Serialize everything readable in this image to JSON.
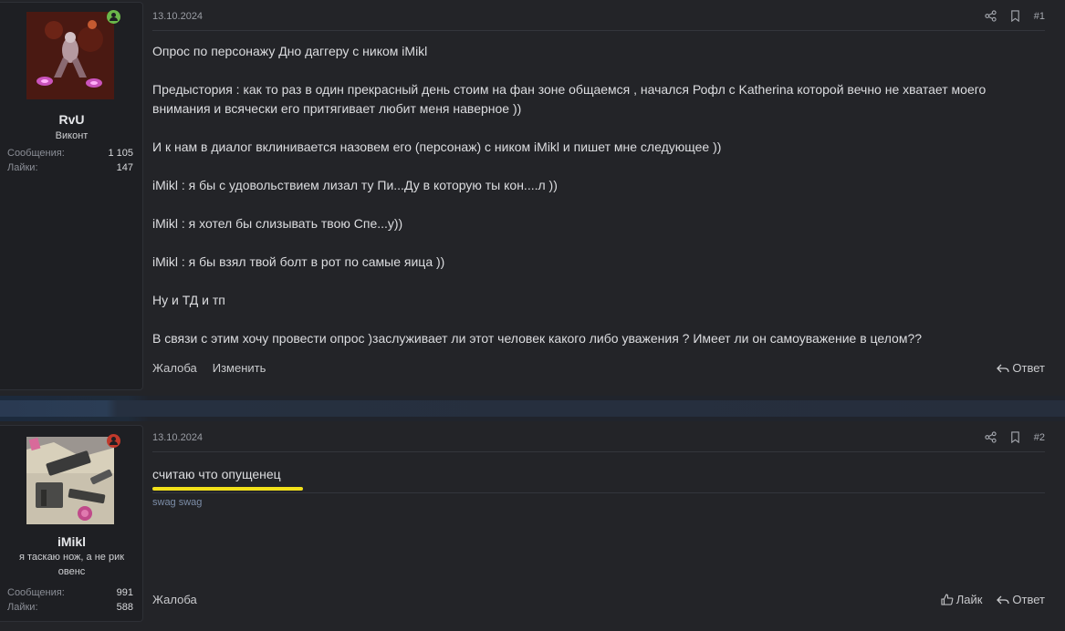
{
  "posts": [
    {
      "author": {
        "name": "RvU",
        "title": "Виконт",
        "online": true,
        "stats": [
          {
            "label": "Сообщения:",
            "value": "1 105"
          },
          {
            "label": "Лайки:",
            "value": "147"
          }
        ]
      },
      "date": "13.10.2024",
      "number": "#1",
      "paragraphs": [
        "Опрос по персонажу Дно даггеру с ником iMikl",
        "Предыстория : как то раз в один прекрасный день стоим на фан зоне общаемся , начался Рофл с Katherina которой вечно не хватает моего внимания и всячески его притягивает любит меня наверное ))",
        "И к нам в диалог вклинивается назовем его (персонаж) с ником iMikl и пишет мне следующее ))",
        "iMikl : я бы с удовольствием лизал ту Пи...Ду в которую ты кон....л ))",
        "iMikl : я хотел бы слизывать твою Спе...у))",
        "iMikl : я бы взял твой болт в рот по самые яица ))",
        "Ну и ТД и тп",
        "В связи с этим хочу провести опрос )заслуживает ли этот человек какого либо уважения ? Имеет ли он самоуважение в целом??"
      ],
      "footer": {
        "report": "Жалоба",
        "edit": "Изменить",
        "reply": "Ответ"
      }
    },
    {
      "author": {
        "name": "iMikl",
        "title": "я таскаю нож, а не рик овенс",
        "online": false,
        "stats": [
          {
            "label": "Сообщения:",
            "value": "991"
          },
          {
            "label": "Лайки:",
            "value": "588"
          }
        ]
      },
      "date": "13.10.2024",
      "number": "#2",
      "message": "считаю что опущенец",
      "signature": "swag swag",
      "footer": {
        "report": "Жалоба",
        "like": "Лайк",
        "reply": "Ответ"
      }
    }
  ],
  "colors": {
    "online": "#6bb84a",
    "offline": "#c0392b",
    "highlight": "#f2e11a"
  },
  "icons": [
    "share-icon",
    "bookmark-icon",
    "reply-icon",
    "like-icon",
    "user-status-icon"
  ]
}
